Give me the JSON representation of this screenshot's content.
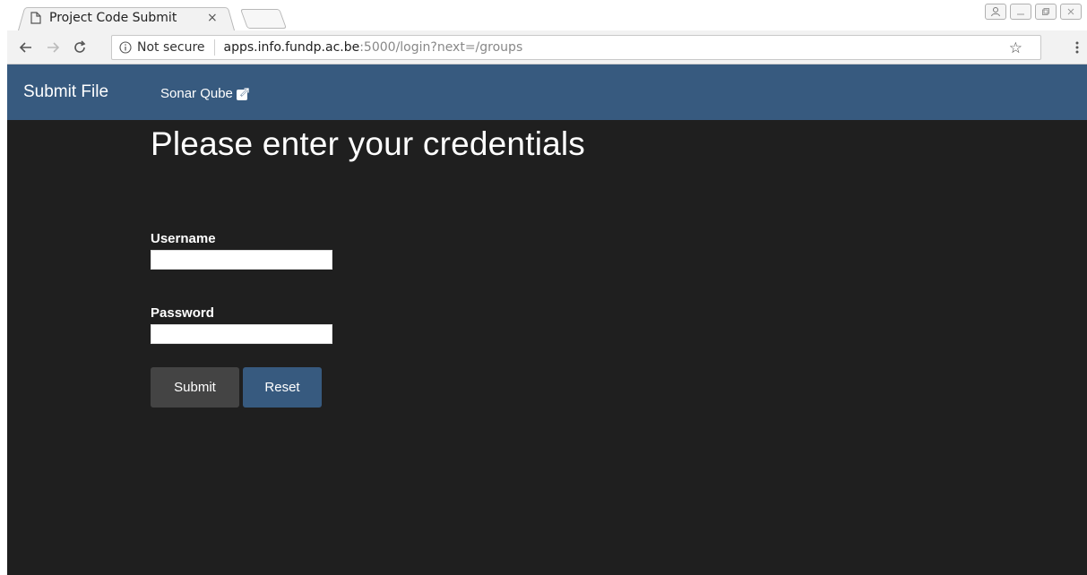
{
  "browser": {
    "tab_title": "Project Code Submit",
    "tab_close": "×",
    "security_label": "Not secure",
    "url_host": "apps.info.fundp.ac.be",
    "url_rest": ":5000/login?next=/groups",
    "icons": {
      "back": "arrow-left-icon",
      "forward": "arrow-right-icon",
      "reload": "reload-icon",
      "info": "info-icon",
      "bookmark": "star-icon",
      "menu": "kebab-menu-icon"
    }
  },
  "navbar": {
    "brand": "Submit File",
    "link": "Sonar Qube",
    "color": "#375a7f"
  },
  "form": {
    "heading": "Please enter your credentials",
    "username_label": "Username",
    "username_value": "",
    "password_label": "Password",
    "password_value": "",
    "submit_label": "Submit",
    "reset_label": "Reset"
  },
  "colors": {
    "background": "#1f1f1f",
    "submit_button": "#444444",
    "reset_button": "#375a7f"
  }
}
